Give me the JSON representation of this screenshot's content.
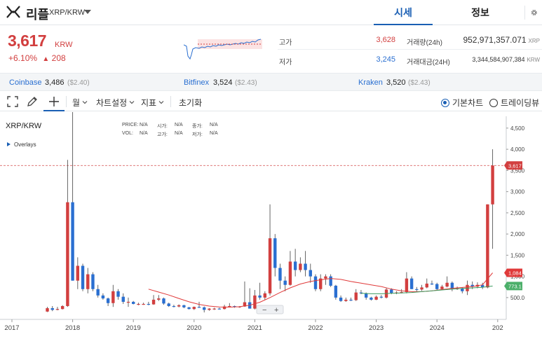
{
  "header": {
    "coin_name": "리플",
    "pair": "XRP/KRW",
    "tabs": [
      {
        "label": "시세",
        "active": true
      },
      {
        "label": "정보",
        "active": false
      }
    ]
  },
  "summary": {
    "price": "3,617",
    "price_unit": "KRW",
    "change_pct": "+6.10%",
    "change_arrow": "▲",
    "change_abs": "208",
    "high_label": "고가",
    "high_value": "3,628",
    "low_label": "저가",
    "low_value": "3,245",
    "volume_label": "거래량(24h)",
    "volume_value": "952,971,357.071",
    "volume_unit": "XRP",
    "amount_label": "거래대금(24H)",
    "amount_value": "3,344,584,907,384",
    "amount_unit": "KRW"
  },
  "exchanges": [
    {
      "name": "Coinbase",
      "price": "3,486",
      "usd": "($2.40)"
    },
    {
      "name": "Bitfinex",
      "price": "3,524",
      "usd": "($2.43)"
    },
    {
      "name": "Kraken",
      "price": "3,520",
      "usd": "($2.43)"
    }
  ],
  "toolbar": {
    "period": "월",
    "chart_settings": "차트설정",
    "indicators": "지표",
    "reset": "초기화",
    "basic_chart": "기본차트",
    "tradingview": "트레이딩뷰",
    "basic_selected": true
  },
  "chart_info": {
    "title": "XRP/KRW",
    "overlays": "Overlays",
    "price_label": "PRICE:",
    "open_label": "시가:",
    "close_label": "종가:",
    "vol_label": "VOL:",
    "high_label": "고가:",
    "low_label": "저가:",
    "na": "N/A",
    "zoom_minus": "−",
    "zoom_plus": "+"
  },
  "colors": {
    "up": "#d23f3f",
    "down": "#2a6fd1",
    "ma_short": "#e03a3a",
    "ma_long": "#3c9a5f",
    "accent": "#1a5fb4"
  },
  "chart_data": {
    "type": "candlestick",
    "title": "XRP/KRW",
    "interval": "month",
    "x_ticks": [
      "2017",
      "2018",
      "2019",
      "2020",
      "2021",
      "2022",
      "2023",
      "2024",
      "202"
    ],
    "y_ticks": [
      "500.0",
      "1,000",
      "1,500",
      "2,000",
      "2,500",
      "3,000",
      "3,500",
      "4,000",
      "4,500"
    ],
    "y_tick_values": [
      500,
      1000,
      1500,
      2000,
      2500,
      3000,
      3500,
      4000,
      4500
    ],
    "ylim": [
      0,
      4900
    ],
    "current_price": {
      "label": "3,617",
      "value": 3617
    },
    "ma_short_last": {
      "label": "1,084",
      "value": 1084
    },
    "ma_long_last": {
      "label": "773.1",
      "value": 773.1
    },
    "candles": [
      {
        "d": "2017-08",
        "o": 170,
        "h": 280,
        "l": 160,
        "c": 250
      },
      {
        "d": "2017-09",
        "o": 250,
        "h": 300,
        "l": 180,
        "c": 210
      },
      {
        "d": "2017-10",
        "o": 210,
        "h": 280,
        "l": 200,
        "c": 230
      },
      {
        "d": "2017-11",
        "o": 230,
        "h": 320,
        "l": 220,
        "c": 300
      },
      {
        "d": "2017-12",
        "o": 300,
        "h": 3750,
        "l": 280,
        "c": 2750
      },
      {
        "d": "2018-01",
        "o": 2750,
        "h": 4900,
        "l": 900,
        "c": 900
      },
      {
        "d": "2018-02",
        "o": 900,
        "h": 1450,
        "l": 700,
        "c": 1250
      },
      {
        "d": "2018-03",
        "o": 1250,
        "h": 1300,
        "l": 650,
        "c": 700
      },
      {
        "d": "2018-04",
        "o": 700,
        "h": 1200,
        "l": 600,
        "c": 1050
      },
      {
        "d": "2018-05",
        "o": 1050,
        "h": 1100,
        "l": 650,
        "c": 700
      },
      {
        "d": "2018-06",
        "o": 700,
        "h": 800,
        "l": 500,
        "c": 550
      },
      {
        "d": "2018-07",
        "o": 550,
        "h": 600,
        "l": 450,
        "c": 480
      },
      {
        "d": "2018-08",
        "o": 480,
        "h": 500,
        "l": 300,
        "c": 370
      },
      {
        "d": "2018-09",
        "o": 370,
        "h": 800,
        "l": 280,
        "c": 650
      },
      {
        "d": "2018-10",
        "o": 650,
        "h": 700,
        "l": 450,
        "c": 520
      },
      {
        "d": "2018-11",
        "o": 520,
        "h": 600,
        "l": 350,
        "c": 400
      },
      {
        "d": "2018-12",
        "o": 400,
        "h": 500,
        "l": 280,
        "c": 400
      },
      {
        "d": "2019-01",
        "o": 400,
        "h": 420,
        "l": 340,
        "c": 350
      },
      {
        "d": "2019-02",
        "o": 350,
        "h": 380,
        "l": 320,
        "c": 350
      },
      {
        "d": "2019-03",
        "o": 350,
        "h": 380,
        "l": 330,
        "c": 350
      },
      {
        "d": "2019-04",
        "o": 350,
        "h": 400,
        "l": 320,
        "c": 340
      },
      {
        "d": "2019-05",
        "o": 340,
        "h": 560,
        "l": 330,
        "c": 450
      },
      {
        "d": "2019-06",
        "o": 450,
        "h": 560,
        "l": 420,
        "c": 480
      },
      {
        "d": "2019-07",
        "o": 480,
        "h": 500,
        "l": 330,
        "c": 360
      },
      {
        "d": "2019-08",
        "o": 360,
        "h": 380,
        "l": 280,
        "c": 300
      },
      {
        "d": "2019-09",
        "o": 300,
        "h": 330,
        "l": 270,
        "c": 290
      },
      {
        "d": "2019-10",
        "o": 290,
        "h": 340,
        "l": 270,
        "c": 320
      },
      {
        "d": "2019-11",
        "o": 320,
        "h": 330,
        "l": 250,
        "c": 270
      },
      {
        "d": "2019-12",
        "o": 270,
        "h": 280,
        "l": 220,
        "c": 230
      },
      {
        "d": "2020-01",
        "o": 230,
        "h": 290,
        "l": 210,
        "c": 280
      },
      {
        "d": "2020-02",
        "o": 280,
        "h": 400,
        "l": 260,
        "c": 270
      },
      {
        "d": "2020-03",
        "o": 270,
        "h": 290,
        "l": 150,
        "c": 210
      },
      {
        "d": "2020-04",
        "o": 210,
        "h": 250,
        "l": 190,
        "c": 240
      },
      {
        "d": "2020-05",
        "o": 240,
        "h": 260,
        "l": 210,
        "c": 240
      },
      {
        "d": "2020-06",
        "o": 240,
        "h": 260,
        "l": 220,
        "c": 230
      },
      {
        "d": "2020-07",
        "o": 230,
        "h": 330,
        "l": 220,
        "c": 290
      },
      {
        "d": "2020-08",
        "o": 290,
        "h": 370,
        "l": 270,
        "c": 300
      },
      {
        "d": "2020-09",
        "o": 300,
        "h": 310,
        "l": 260,
        "c": 280
      },
      {
        "d": "2020-10",
        "o": 280,
        "h": 300,
        "l": 260,
        "c": 290
      },
      {
        "d": "2020-11",
        "o": 290,
        "h": 880,
        "l": 280,
        "c": 390
      },
      {
        "d": "2020-12",
        "o": 390,
        "h": 720,
        "l": 240,
        "c": 240
      },
      {
        "d": "2021-01",
        "o": 240,
        "h": 680,
        "l": 220,
        "c": 550
      },
      {
        "d": "2021-02",
        "o": 550,
        "h": 850,
        "l": 450,
        "c": 500
      },
      {
        "d": "2021-03",
        "o": 500,
        "h": 650,
        "l": 450,
        "c": 600
      },
      {
        "d": "2021-04",
        "o": 600,
        "h": 2700,
        "l": 550,
        "c": 1900
      },
      {
        "d": "2021-05",
        "o": 1900,
        "h": 2000,
        "l": 1000,
        "c": 1200
      },
      {
        "d": "2021-06",
        "o": 1200,
        "h": 1300,
        "l": 700,
        "c": 900
      },
      {
        "d": "2021-07",
        "o": 900,
        "h": 1000,
        "l": 650,
        "c": 800
      },
      {
        "d": "2021-08",
        "o": 800,
        "h": 1600,
        "l": 780,
        "c": 1350
      },
      {
        "d": "2021-09",
        "o": 1350,
        "h": 1650,
        "l": 1000,
        "c": 1150
      },
      {
        "d": "2021-10",
        "o": 1150,
        "h": 1450,
        "l": 1100,
        "c": 1300
      },
      {
        "d": "2021-11",
        "o": 1300,
        "h": 1600,
        "l": 1000,
        "c": 1150
      },
      {
        "d": "2021-12",
        "o": 1150,
        "h": 1300,
        "l": 850,
        "c": 1000
      },
      {
        "d": "2022-01",
        "o": 1000,
        "h": 1050,
        "l": 650,
        "c": 700
      },
      {
        "d": "2022-02",
        "o": 700,
        "h": 1050,
        "l": 650,
        "c": 950
      },
      {
        "d": "2022-03",
        "o": 950,
        "h": 1050,
        "l": 800,
        "c": 1000
      },
      {
        "d": "2022-04",
        "o": 1000,
        "h": 1050,
        "l": 750,
        "c": 780
      },
      {
        "d": "2022-05",
        "o": 780,
        "h": 800,
        "l": 450,
        "c": 500
      },
      {
        "d": "2022-06",
        "o": 500,
        "h": 550,
        "l": 400,
        "c": 420
      },
      {
        "d": "2022-07",
        "o": 420,
        "h": 500,
        "l": 400,
        "c": 450
      },
      {
        "d": "2022-08",
        "o": 450,
        "h": 500,
        "l": 420,
        "c": 440
      },
      {
        "d": "2022-09",
        "o": 440,
        "h": 700,
        "l": 420,
        "c": 620
      },
      {
        "d": "2022-10",
        "o": 620,
        "h": 680,
        "l": 580,
        "c": 600
      },
      {
        "d": "2022-11",
        "o": 600,
        "h": 620,
        "l": 450,
        "c": 500
      },
      {
        "d": "2022-12",
        "o": 500,
        "h": 520,
        "l": 430,
        "c": 450
      },
      {
        "d": "2023-01",
        "o": 450,
        "h": 550,
        "l": 440,
        "c": 520
      },
      {
        "d": "2023-02",
        "o": 520,
        "h": 560,
        "l": 480,
        "c": 500
      },
      {
        "d": "2023-03",
        "o": 500,
        "h": 730,
        "l": 480,
        "c": 690
      },
      {
        "d": "2023-04",
        "o": 690,
        "h": 720,
        "l": 580,
        "c": 610
      },
      {
        "d": "2023-05",
        "o": 610,
        "h": 650,
        "l": 580,
        "c": 620
      },
      {
        "d": "2023-06",
        "o": 620,
        "h": 700,
        "l": 600,
        "c": 630
      },
      {
        "d": "2023-07",
        "o": 630,
        "h": 1100,
        "l": 600,
        "c": 950
      },
      {
        "d": "2023-08",
        "o": 950,
        "h": 1000,
        "l": 700,
        "c": 700
      },
      {
        "d": "2023-09",
        "o": 700,
        "h": 750,
        "l": 650,
        "c": 690
      },
      {
        "d": "2023-10",
        "o": 690,
        "h": 800,
        "l": 660,
        "c": 740
      },
      {
        "d": "2023-11",
        "o": 740,
        "h": 950,
        "l": 720,
        "c": 830
      },
      {
        "d": "2023-12",
        "o": 830,
        "h": 900,
        "l": 800,
        "c": 820
      },
      {
        "d": "2024-01",
        "o": 820,
        "h": 850,
        "l": 680,
        "c": 700
      },
      {
        "d": "2024-02",
        "o": 700,
        "h": 800,
        "l": 680,
        "c": 760
      },
      {
        "d": "2024-03",
        "o": 760,
        "h": 1000,
        "l": 740,
        "c": 850
      },
      {
        "d": "2024-04",
        "o": 850,
        "h": 880,
        "l": 650,
        "c": 700
      },
      {
        "d": "2024-05",
        "o": 700,
        "h": 760,
        "l": 680,
        "c": 720
      },
      {
        "d": "2024-06",
        "o": 720,
        "h": 740,
        "l": 600,
        "c": 650
      },
      {
        "d": "2024-07",
        "o": 650,
        "h": 900,
        "l": 560,
        "c": 800
      },
      {
        "d": "2024-08",
        "o": 800,
        "h": 880,
        "l": 700,
        "c": 760
      },
      {
        "d": "2024-09",
        "o": 760,
        "h": 860,
        "l": 720,
        "c": 800
      },
      {
        "d": "2024-10",
        "o": 800,
        "h": 850,
        "l": 700,
        "c": 740
      },
      {
        "d": "2024-11",
        "o": 740,
        "h": 2700,
        "l": 720,
        "c": 2700
      },
      {
        "d": "2024-12",
        "o": 2700,
        "h": 4000,
        "l": 1650,
        "c": 3617
      }
    ],
    "ma_short": [
      {
        "d": "2019-04",
        "v": 700
      },
      {
        "d": "2019-06",
        "v": 630
      },
      {
        "d": "2019-08",
        "v": 560
      },
      {
        "d": "2019-10",
        "v": 480
      },
      {
        "d": "2019-12",
        "v": 400
      },
      {
        "d": "2020-02",
        "v": 340
      },
      {
        "d": "2020-04",
        "v": 300
      },
      {
        "d": "2020-06",
        "v": 280
      },
      {
        "d": "2020-08",
        "v": 275
      },
      {
        "d": "2020-10",
        "v": 285
      },
      {
        "d": "2020-12",
        "v": 320
      },
      {
        "d": "2021-02",
        "v": 390
      },
      {
        "d": "2021-04",
        "v": 500
      },
      {
        "d": "2021-06",
        "v": 620
      },
      {
        "d": "2021-08",
        "v": 730
      },
      {
        "d": "2021-10",
        "v": 820
      },
      {
        "d": "2021-12",
        "v": 880
      },
      {
        "d": "2022-02",
        "v": 920
      },
      {
        "d": "2022-04",
        "v": 950
      },
      {
        "d": "2022-06",
        "v": 930
      },
      {
        "d": "2022-08",
        "v": 880
      },
      {
        "d": "2022-10",
        "v": 840
      },
      {
        "d": "2022-12",
        "v": 800
      },
      {
        "d": "2023-02",
        "v": 760
      },
      {
        "d": "2023-04",
        "v": 700
      },
      {
        "d": "2023-06",
        "v": 660
      },
      {
        "d": "2023-08",
        "v": 640
      },
      {
        "d": "2023-10",
        "v": 640
      },
      {
        "d": "2023-12",
        "v": 660
      },
      {
        "d": "2024-02",
        "v": 690
      },
      {
        "d": "2024-04",
        "v": 720
      },
      {
        "d": "2024-06",
        "v": 740
      },
      {
        "d": "2024-08",
        "v": 760
      },
      {
        "d": "2024-10",
        "v": 800
      },
      {
        "d": "2024-12",
        "v": 1084
      }
    ],
    "ma_long": [
      {
        "d": "2022-10",
        "v": 600
      },
      {
        "d": "2022-12",
        "v": 590
      },
      {
        "d": "2023-02",
        "v": 590
      },
      {
        "d": "2023-04",
        "v": 600
      },
      {
        "d": "2023-06",
        "v": 610
      },
      {
        "d": "2023-08",
        "v": 620
      },
      {
        "d": "2023-10",
        "v": 640
      },
      {
        "d": "2023-12",
        "v": 660
      },
      {
        "d": "2024-02",
        "v": 680
      },
      {
        "d": "2024-04",
        "v": 700
      },
      {
        "d": "2024-06",
        "v": 715
      },
      {
        "d": "2024-08",
        "v": 730
      },
      {
        "d": "2024-10",
        "v": 745
      },
      {
        "d": "2024-12",
        "v": 773.1
      }
    ]
  }
}
